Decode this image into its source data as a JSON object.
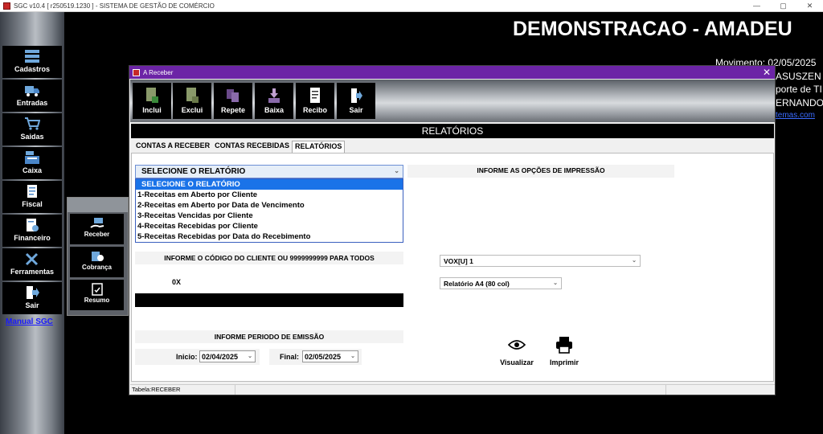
{
  "app": {
    "title": "SGC v10.4 [ r250519.1230 ] - SISTEMA DE GESTÃO DE COMÉRCIO",
    "window_controls": [
      "—",
      "▢",
      "✕"
    ]
  },
  "sidebar": {
    "items": [
      {
        "label": "Cadastros",
        "icon": "stack-icon"
      },
      {
        "label": "Entradas",
        "icon": "truck-icon"
      },
      {
        "label": "Saidas",
        "icon": "cart-icon"
      },
      {
        "label": "Caixa",
        "icon": "register-icon"
      },
      {
        "label": "Fiscal",
        "icon": "document-icon"
      },
      {
        "label": "Financeiro",
        "icon": "money-document-icon"
      },
      {
        "label": "Ferramentas",
        "icon": "tools-icon"
      },
      {
        "label": "Sair",
        "icon": "exit-icon"
      }
    ],
    "manual_link": "Manual SGC"
  },
  "subpanel": {
    "items": [
      {
        "label": "Receber",
        "icon": "receive-money-icon"
      },
      {
        "label": "Cobrança",
        "icon": "collection-icon"
      },
      {
        "label": "Resumo",
        "icon": "summary-icon"
      }
    ]
  },
  "background": {
    "company_title": "DEMONSTRACAO - AMADEU",
    "movimento": "Movimento: 02/05/2025",
    "line2": "ASUSZEN",
    "line3": "porte de TI",
    "line4": "ERNANDO",
    "link": "temas.com"
  },
  "dialog": {
    "title": "A Receber",
    "toolbar": [
      {
        "label": "Inclui",
        "icon": "add-document-icon"
      },
      {
        "label": "Exclui",
        "icon": "delete-document-icon"
      },
      {
        "label": "Repete",
        "icon": "repeat-icon"
      },
      {
        "label": "Baixa",
        "icon": "download-icon"
      },
      {
        "label": "Recibo",
        "icon": "receipt-icon"
      },
      {
        "label": "Sair",
        "icon": "exit-icon"
      }
    ],
    "section_title": "RELATÓRIOS",
    "tabs": [
      "CONTAS A RECEBER",
      "CONTAS RECEBIDAS",
      "RELATÓRIOS"
    ],
    "active_tab": "RELATÓRIOS",
    "report_select": {
      "value": "SELECIONE O RELATÓRIO",
      "options": [
        "SELECIONE O RELATÓRIO",
        "1-Receitas em Aberto por Cliente",
        "2-Receitas em Aberto por Data de Vencimento",
        "3-Receitas Vencidas por Cliente",
        "4-Receitas Recebidas por Cliente",
        "5-Receitas Recebidas por Data do Recebimento"
      ]
    },
    "print_options_label": "INFORME AS OPÇÕES DE IMPRESSÃO",
    "client_code_label": "INFORME O CÓDIGO DO CLIENTE OU 9999999999 PARA TODOS",
    "client_code_value": "0X",
    "printer_select": "VOX[U] 1",
    "format_select": "Relatório A4 (80 col)",
    "period_label": "INFORME PERIODO DE EMISSÃO",
    "start_label": "Inicio:",
    "start_date": "02/04/2025",
    "end_label": "Final:",
    "end_date": "02/05/2025",
    "view_button": "Visualizar",
    "print_button": "Imprimir",
    "status_table": "Tabela:RECEBER"
  }
}
